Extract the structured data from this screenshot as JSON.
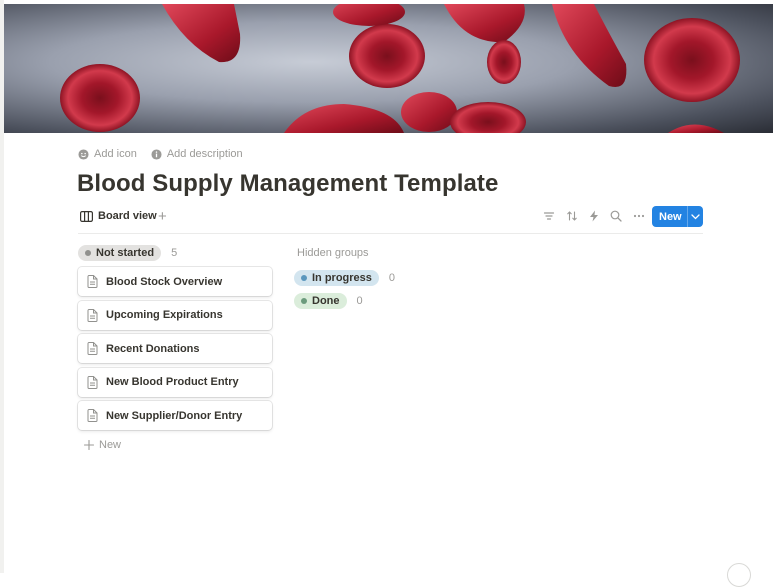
{
  "page": {
    "add_icon": "Add icon",
    "add_description": "Add description",
    "title": "Blood Supply Management Template"
  },
  "view_bar": {
    "view_name": "Board view",
    "add_view": "+",
    "tools": [
      "filter-icon",
      "sort-icon",
      "automation-icon",
      "search-icon",
      "more-icon"
    ],
    "new_label": "New"
  },
  "board": {
    "group": {
      "label": "Not started",
      "count": "5",
      "color": "#e3e2e0"
    },
    "cards": [
      {
        "title": "Blood Stock Overview"
      },
      {
        "title": "Upcoming Expirations"
      },
      {
        "title": "Recent Donations"
      },
      {
        "title": "New Blood Product Entry"
      },
      {
        "title": "New Supplier/Donor Entry"
      }
    ],
    "add_new_label": "New"
  },
  "hidden_groups": {
    "label": "Hidden groups",
    "groups": [
      {
        "label": "In progress",
        "count": "0",
        "color": "#d3e5ef"
      },
      {
        "label": "Done",
        "count": "0",
        "color": "#dbeddb"
      }
    ]
  }
}
